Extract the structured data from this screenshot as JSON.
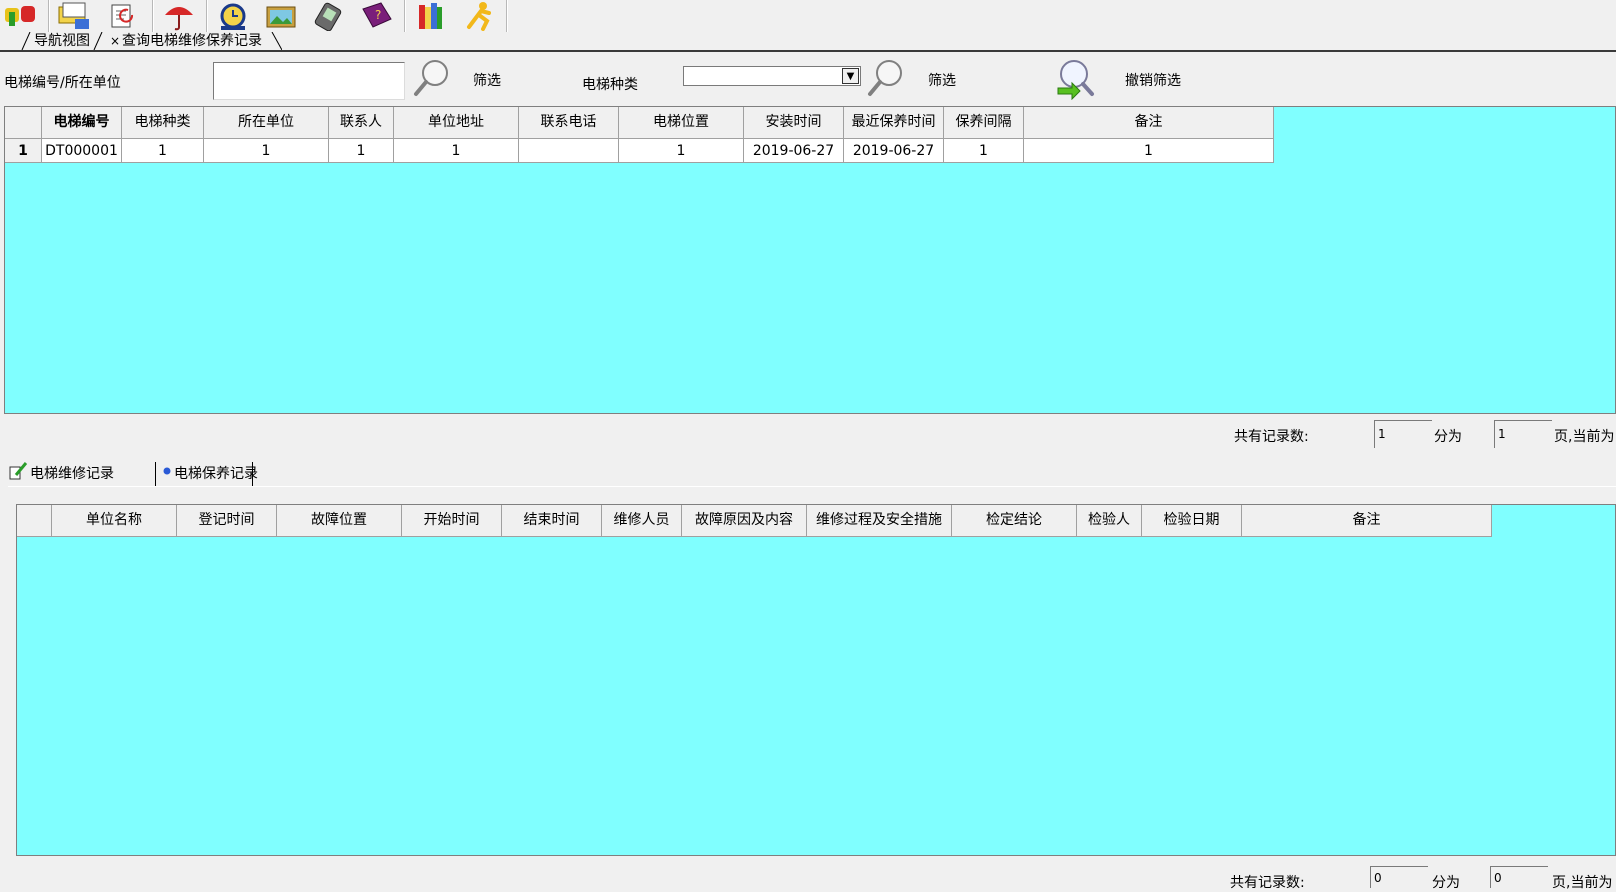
{
  "toolbar": {
    "icons": [
      "tools-icon",
      "folder-network-icon",
      "document-refresh-icon",
      "umbrella-icon",
      "alarm-clock-icon",
      "picture-icon",
      "handheld-icon",
      "help-book-icon",
      "books-icon",
      "running-man-icon"
    ]
  },
  "nav_tabs": {
    "tab1": "导航视图",
    "tab2_close": "×",
    "tab2": "查询电梯维修保养记录"
  },
  "filter": {
    "label_code_unit": "电梯编号/所在单位",
    "code_unit_value": "",
    "filter_btn1": "筛选",
    "label_type": "电梯种类",
    "type_value": "",
    "filter_btn2": "筛选",
    "cancel_filter": "撤销筛选"
  },
  "elevator_table": {
    "columns": [
      "电梯编号",
      "电梯种类",
      "所在单位",
      "联系人",
      "单位地址",
      "联系电话",
      "电梯位置",
      "安装时间",
      "最近保养时间",
      "保养间隔",
      "备注"
    ],
    "rows": [
      {
        "num": "1",
        "cells": [
          "DT000001",
          "1",
          "1",
          "1",
          "1",
          "",
          "1",
          "2019-06-27",
          "2019-06-27",
          "1",
          "1"
        ]
      }
    ]
  },
  "pager1": {
    "total_label": "共有记录数:",
    "total_value": "1",
    "split_label": "分为",
    "pages_value": "1",
    "page_label": "页,当前为"
  },
  "sub_tabs": {
    "repair": "电梯维修记录",
    "maintenance": "电梯保养记录"
  },
  "repair_table": {
    "columns": [
      "单位名称",
      "登记时间",
      "故障位置",
      "开始时间",
      "结束时间",
      "维修人员",
      "故障原因及内容",
      "维修过程及安全措施",
      "检定结论",
      "检验人",
      "检验日期",
      "备注"
    ]
  },
  "pager2": {
    "total_label": "共有记录数:",
    "total_value": "0",
    "split_label": "分为",
    "pages_value": "0",
    "page_label": "页,当前为"
  },
  "colors": {
    "grid_bg": "#80ffff",
    "window_bg": "#f0f0f0"
  }
}
